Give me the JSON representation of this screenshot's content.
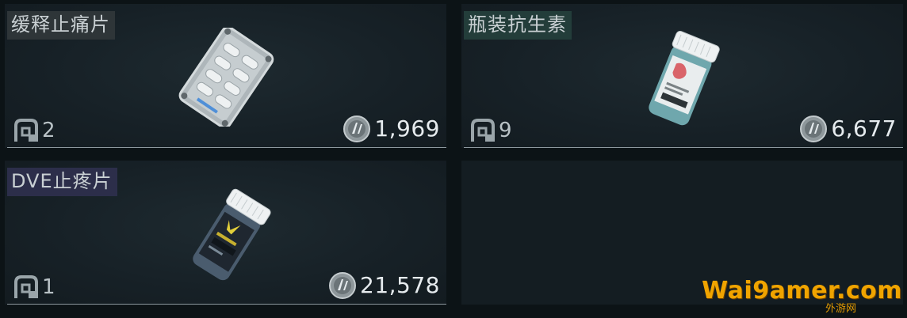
{
  "items": [
    {
      "name": "缓释止痛片",
      "weight": "2",
      "price": "1,969"
    },
    {
      "name": "瓶装抗生素",
      "weight": "9",
      "price": "6,677"
    },
    {
      "name": "DVE止疼片",
      "weight": "1",
      "price": "21,578"
    }
  ],
  "watermark": {
    "main": "Wai9amer",
    "domain": ".com",
    "sub": "外游网"
  },
  "icons": {
    "weight": "weight-icon",
    "currency": "credits-icon"
  },
  "colors": {
    "background": "#0c1316",
    "card": "#172127",
    "watermark": "#f0a400"
  }
}
